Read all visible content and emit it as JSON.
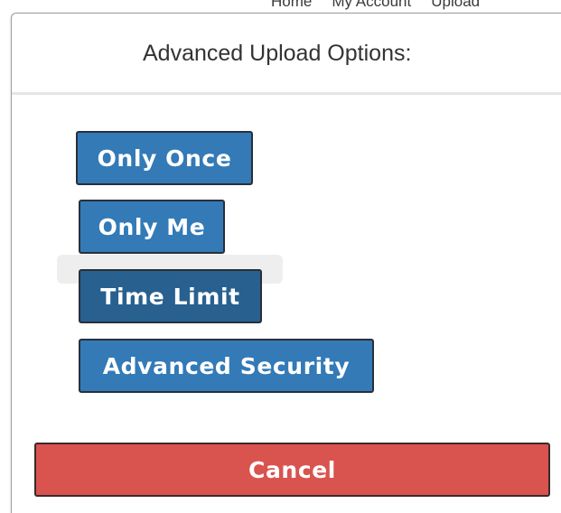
{
  "background": {
    "nav_items": [
      "Home",
      "My Account",
      "Upload"
    ]
  },
  "modal": {
    "title": "Advanced Upload Options:",
    "options": {
      "only_once": "Only Once",
      "only_me": "Only Me",
      "time_limit": "Time Limit",
      "advanced_security": "Advanced Security"
    },
    "cancel_label": "Cancel"
  },
  "colors": {
    "primary": "#337ab7",
    "primary_active": "#286090",
    "danger": "#d9534f"
  }
}
